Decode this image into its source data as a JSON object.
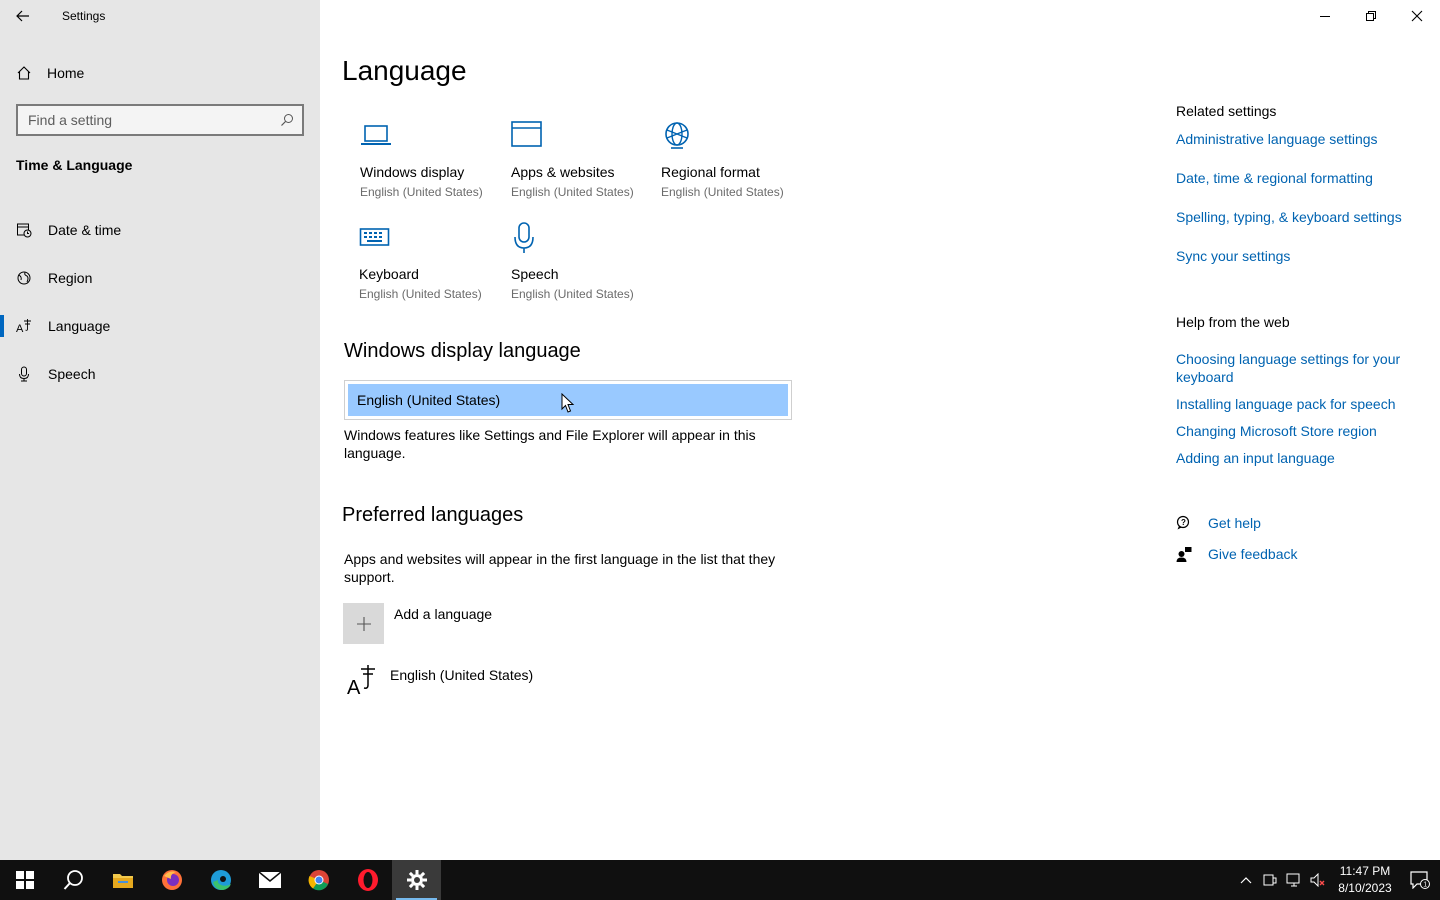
{
  "window": {
    "title": "Settings",
    "controls": [
      "minimize",
      "restore",
      "close"
    ]
  },
  "sidebar": {
    "home_label": "Home",
    "search_placeholder": "Find a setting",
    "section_title": "Time & Language",
    "items": [
      {
        "label": "Date & time",
        "icon": "calendar-clock-icon"
      },
      {
        "label": "Region",
        "icon": "globe-icon"
      },
      {
        "label": "Language",
        "icon": "language-icon",
        "active": true
      },
      {
        "label": "Speech",
        "icon": "microphone-icon"
      }
    ]
  },
  "main": {
    "title": "Language",
    "tiles": [
      {
        "title": "Windows display",
        "subtitle": "English (United States)",
        "icon": "laptop-icon"
      },
      {
        "title": "Apps & websites",
        "subtitle": "English (United States)",
        "icon": "browser-window-icon"
      },
      {
        "title": "Regional format",
        "subtitle": "English (United States)",
        "icon": "globe-icon"
      },
      {
        "title": "Keyboard",
        "subtitle": "English (United States)",
        "icon": "keyboard-icon"
      },
      {
        "title": "Speech",
        "subtitle": "English (United States)",
        "icon": "microphone-icon"
      }
    ],
    "display_language": {
      "heading": "Windows display language",
      "selected": "English (United States)",
      "description": "Windows features like Settings and File Explorer will appear in this language."
    },
    "preferred": {
      "heading": "Preferred languages",
      "description": "Apps and websites will appear in the first language in the list that they support.",
      "add_label": "Add a language",
      "languages": [
        "English (United States)"
      ]
    }
  },
  "related": {
    "title": "Related settings",
    "links": [
      "Administrative language settings",
      "Date, time & regional formatting",
      "Spelling, typing, & keyboard settings",
      "Sync your settings"
    ]
  },
  "help": {
    "title": "Help from the web",
    "links": [
      "Choosing language settings for your keyboard",
      "Installing language pack for speech",
      "Changing Microsoft Store region",
      "Adding an input language"
    ],
    "get_help": "Get help",
    "give_feedback": "Give feedback"
  },
  "taskbar": {
    "apps": [
      "start-icon",
      "search-icon",
      "file-explorer-icon",
      "firefox-icon",
      "edge-icon",
      "mail-icon",
      "chrome-icon",
      "opera-icon",
      "settings-icon"
    ],
    "time": "11:47 PM",
    "date": "8/10/2023",
    "notification_count": "1"
  },
  "colors": {
    "sidebar_bg": "#e6e6e6",
    "accent": "#0067c0",
    "link": "#0063b1",
    "selection": "#99c9ff",
    "taskbar": "#101010"
  }
}
